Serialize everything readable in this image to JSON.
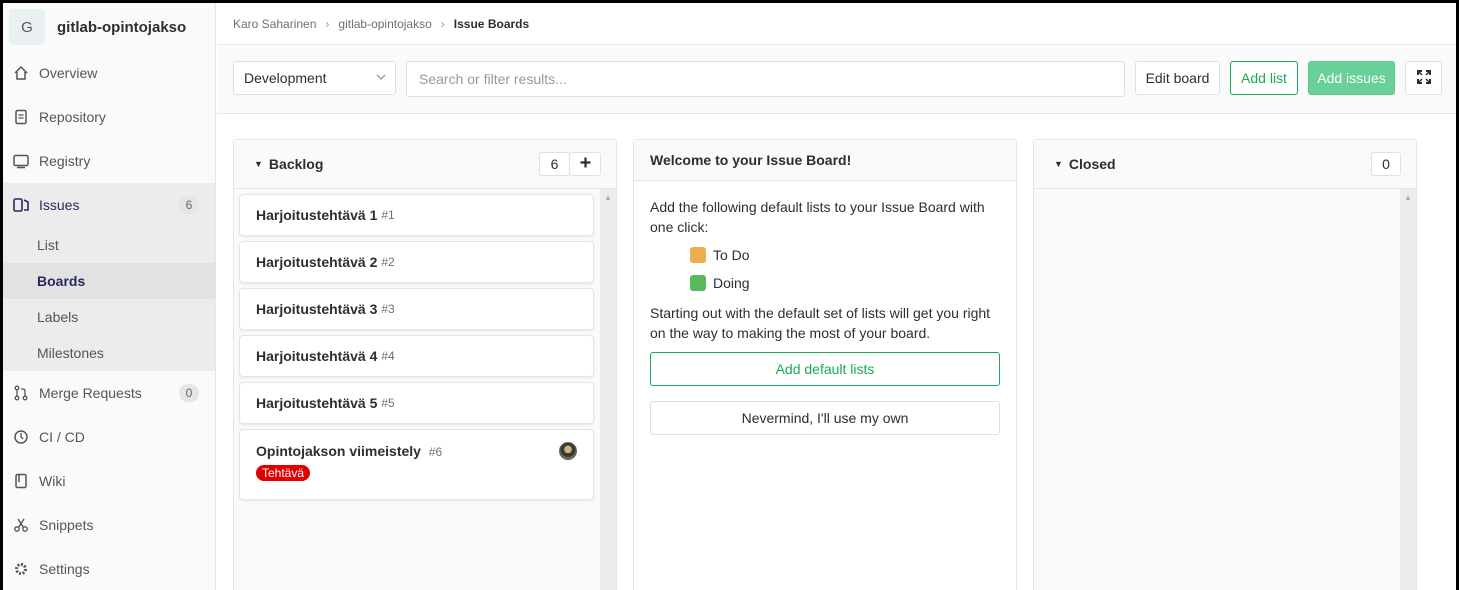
{
  "project": {
    "avatar_letter": "G",
    "name": "gitlab-opintojakso"
  },
  "sidebar": {
    "items": [
      {
        "label": "Overview",
        "icon": "home-icon"
      },
      {
        "label": "Repository",
        "icon": "doc-icon"
      },
      {
        "label": "Registry",
        "icon": "container-icon"
      },
      {
        "label": "Issues",
        "icon": "issues-icon",
        "count": "6"
      },
      {
        "label": "Merge Requests",
        "icon": "merge-request-icon",
        "count": "0"
      },
      {
        "label": "CI / CD",
        "icon": "rocket-icon"
      },
      {
        "label": "Wiki",
        "icon": "book-icon"
      },
      {
        "label": "Snippets",
        "icon": "scissors-icon"
      },
      {
        "label": "Settings",
        "icon": "gear-icon"
      }
    ],
    "issues_sub": [
      "List",
      "Boards",
      "Labels",
      "Milestones"
    ]
  },
  "breadcrumb": {
    "items": [
      "Karo Saharinen",
      "gitlab-opintojakso"
    ],
    "current": "Issue Boards"
  },
  "filterbar": {
    "board_select": "Development",
    "search_placeholder": "Search or filter results...",
    "edit_board": "Edit board",
    "add_list": "Add list",
    "add_issues": "Add issues"
  },
  "backlog": {
    "title": "Backlog",
    "count": "6",
    "cards": [
      {
        "title": "Harjoitustehtävä 1",
        "num": "#1"
      },
      {
        "title": "Harjoitustehtävä 2",
        "num": "#2"
      },
      {
        "title": "Harjoitustehtävä 3",
        "num": "#3"
      },
      {
        "title": "Harjoitustehtävä 4",
        "num": "#4"
      },
      {
        "title": "Harjoitustehtävä 5",
        "num": "#5"
      },
      {
        "title": "Opintojakson viimeistely",
        "num": "#6",
        "label": "Tehtävä",
        "label_color": "#e00000"
      }
    ]
  },
  "welcome": {
    "title": "Welcome to your Issue Board!",
    "intro": "Add the following default lists to your Issue Board with one click:",
    "lists": [
      {
        "label": "To Do",
        "color": "#f0ad4e"
      },
      {
        "label": "Doing",
        "color": "#5cb85c"
      }
    ],
    "outro": "Starting out with the default set of lists will get you right on the way to making the most of your board.",
    "add_default": "Add default lists",
    "nevermind": "Nevermind, I'll use my own"
  },
  "closed": {
    "title": "Closed",
    "count": "0"
  },
  "colors": {
    "accent_green": "#1aaa55",
    "active_nav": "#292961"
  }
}
